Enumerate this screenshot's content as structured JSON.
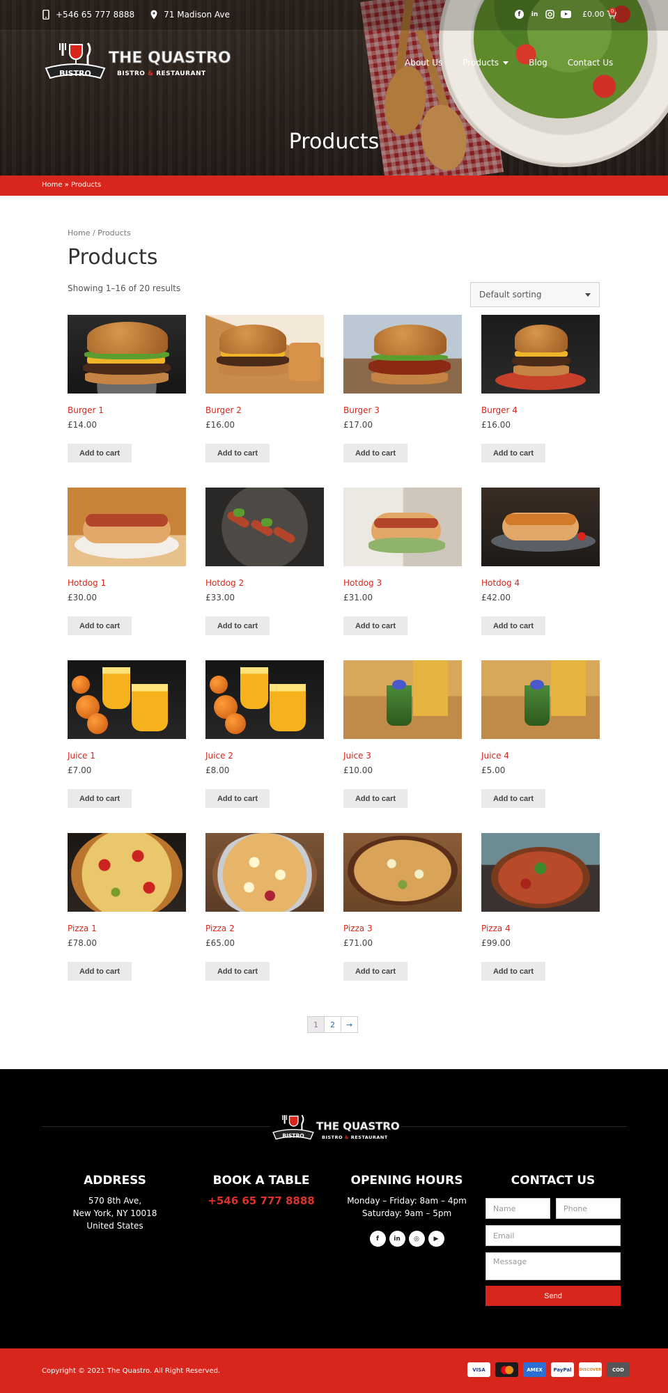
{
  "topbar": {
    "phone": "+546 65 777 8888",
    "address": "71 Madison Ave",
    "social": [
      "facebook-icon",
      "linkedin-icon",
      "instagram-icon",
      "youtube-icon"
    ],
    "cart_total": "£0.00",
    "cart_count": "0"
  },
  "brand": {
    "name": "THE QUASTRO",
    "badge": "BISTRO",
    "sub_left": "BISTRO",
    "sub_amp": "&",
    "sub_right": "RESTAURANT"
  },
  "nav": {
    "items": [
      "About Us",
      "Products",
      "Blog",
      "Contact Us"
    ]
  },
  "hero": {
    "title": "Products"
  },
  "redbar": {
    "breadcrumb": "Home » Products"
  },
  "main": {
    "breadcrumb": "Home / Products",
    "title": "Products",
    "result_count": "Showing 1–16 of 20 results",
    "sort_selected": "Default sorting",
    "add_to_cart_label": "Add to cart",
    "products": [
      {
        "name": "Burger 1",
        "price": "£14.00"
      },
      {
        "name": "Burger 2",
        "price": "£16.00"
      },
      {
        "name": "Burger 3",
        "price": "£17.00"
      },
      {
        "name": "Burger 4",
        "price": "£16.00"
      },
      {
        "name": "Hotdog 1",
        "price": "£30.00"
      },
      {
        "name": "Hotdog 2",
        "price": "£33.00"
      },
      {
        "name": "Hotdog 3",
        "price": "£31.00"
      },
      {
        "name": "Hotdog 4",
        "price": "£42.00"
      },
      {
        "name": "Juice 1",
        "price": "£7.00"
      },
      {
        "name": "Juice 2",
        "price": "£8.00"
      },
      {
        "name": "Juice 3",
        "price": "£10.00"
      },
      {
        "name": "Juice 4",
        "price": "£5.00"
      },
      {
        "name": "Pizza 1",
        "price": "£78.00"
      },
      {
        "name": "Pizza 2",
        "price": "£65.00"
      },
      {
        "name": "Pizza 3",
        "price": "£71.00"
      },
      {
        "name": "Pizza 4",
        "price": "£99.00"
      }
    ],
    "pagination": {
      "current": "1",
      "next_page": "2",
      "next_arrow": "→"
    }
  },
  "footer": {
    "address_heading": "ADDRESS",
    "address_line1": "570 8th Ave,",
    "address_line2": "New York, NY 10018",
    "address_line3": "United States",
    "book_heading": "BOOK A TABLE",
    "book_phone": "+546 65 777 8888",
    "hours_heading": "OPENING HOURS",
    "hours_line1": "Monday – Friday: 8am – 4pm",
    "hours_line2": "Saturday: 9am – 5pm",
    "contact_heading": "CONTACT US",
    "form": {
      "name_placeholder": "Name",
      "phone_placeholder": "Phone",
      "email_placeholder": "Email",
      "message_placeholder": "Message",
      "send_label": "Send"
    },
    "copyright": "Copyright © 2021 The Quastro. All Right Reserved.",
    "payments": [
      "VISA",
      "MC",
      "AMEX",
      "PayPal",
      "DISCOVER",
      "COD"
    ]
  },
  "colors": {
    "accent_red": "#d9261c",
    "link_blue": "#2b6cb0",
    "footer_bg": "#000000"
  }
}
